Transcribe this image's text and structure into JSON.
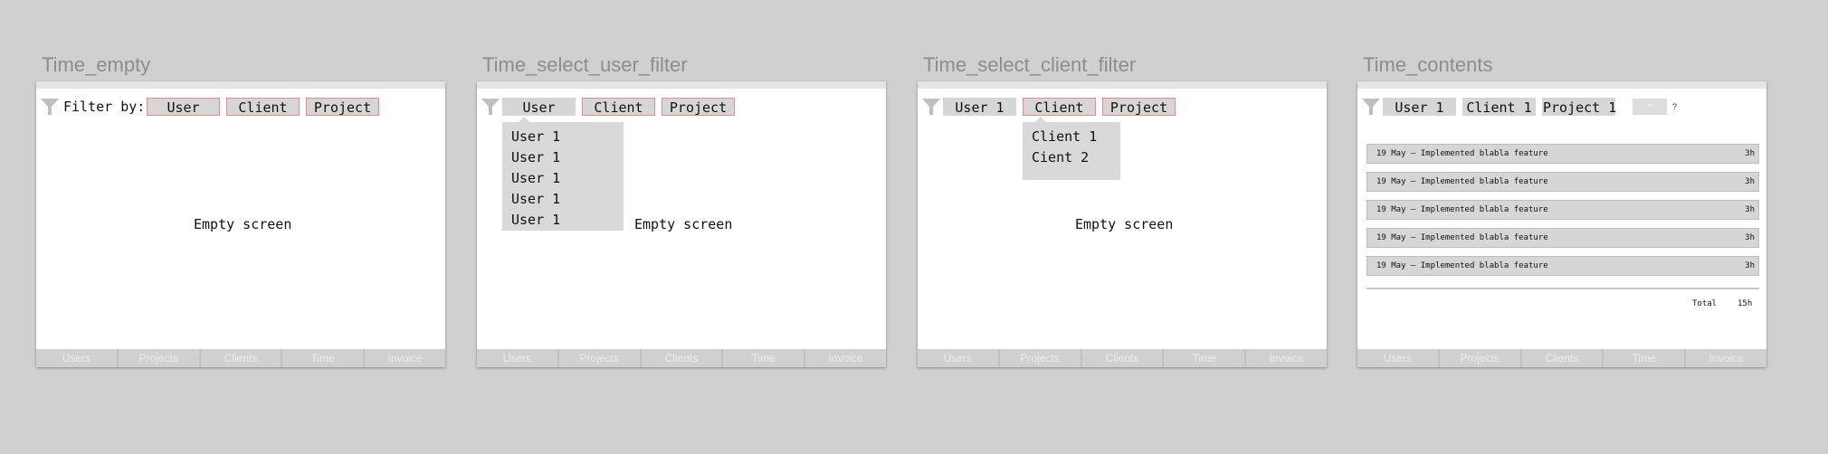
{
  "boards": [
    {
      "title": "Time_empty",
      "filter_label": "Filter by:",
      "filters": [
        "User",
        "Client",
        "Project"
      ],
      "empty_text": "Empty screen",
      "nav": [
        "Users",
        "Projects",
        "Clients",
        "Time",
        "Invoice"
      ]
    },
    {
      "title": "Time_select_user_filter",
      "filters": [
        "User",
        "Client",
        "Project"
      ],
      "dropdown_options": [
        "User 1",
        "User 1",
        "User 1",
        "User 1",
        "User 1"
      ],
      "empty_text": "Empty screen",
      "nav": [
        "Users",
        "Projects",
        "Clients",
        "Time",
        "Invoice"
      ]
    },
    {
      "title": "Time_select_client_filter",
      "filters": [
        "User 1",
        "Client",
        "Project"
      ],
      "dropdown_options": [
        "Client 1",
        "Cient 2"
      ],
      "empty_text": "Empty screen",
      "nav": [
        "Users",
        "Projects",
        "Clients",
        "Time",
        "Invoice"
      ]
    },
    {
      "title": "Time_contents",
      "filters": [
        "User 1",
        "Client 1",
        "Project 1"
      ],
      "add_button": "+",
      "help_mark": "?",
      "entries": [
        {
          "description": "19 May – Implemented blabla feature",
          "hours": "3h"
        },
        {
          "description": "19 May – Implemented blabla feature",
          "hours": "3h"
        },
        {
          "description": "19 May – Implemented blabla feature",
          "hours": "3h"
        },
        {
          "description": "19 May – Implemented blabla feature",
          "hours": "3h"
        },
        {
          "description": "19 May – Implemented blabla feature",
          "hours": "3h"
        }
      ],
      "total_label": "Total",
      "total_value": "15h",
      "nav": [
        "Users",
        "Projects",
        "Clients",
        "Time",
        "Invoice"
      ]
    }
  ]
}
